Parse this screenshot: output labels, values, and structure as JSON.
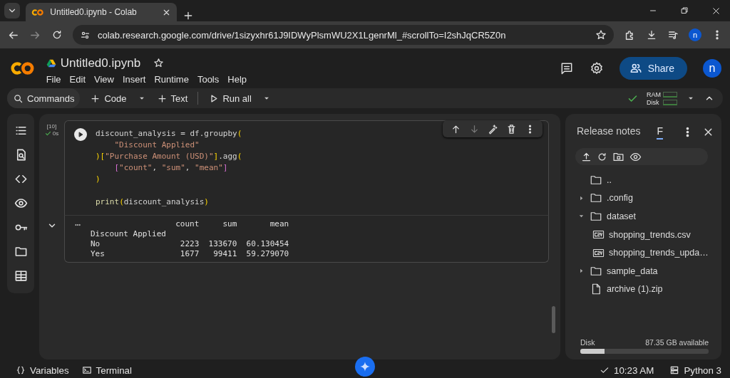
{
  "browser": {
    "tab_title": "Untitled0.ipynb - Colab",
    "url": "colab.research.google.com/drive/1sizyxhr61J9IDWyPlsmWU2X1LgenrMl_#scrollTo=I2shJqCR5Z0n",
    "profile": "n"
  },
  "header": {
    "title": "Untitled0.ipynb",
    "starred": false,
    "menu": [
      "File",
      "Edit",
      "View",
      "Insert",
      "Runtime",
      "Tools",
      "Help"
    ],
    "share": "Share",
    "avatar": "n"
  },
  "toolbar": {
    "commands": "Commands",
    "code": "Code",
    "text": "Text",
    "run_all": "Run all",
    "ram": "RAM",
    "disk": "Disk",
    "connected": true
  },
  "sidebar": [
    {
      "kind": "toc"
    },
    {
      "kind": "find"
    },
    {
      "kind": "snippets"
    },
    {
      "kind": "variables"
    },
    {
      "kind": "secrets"
    },
    {
      "kind": "files"
    },
    {
      "kind": "data"
    }
  ],
  "cell": {
    "exec_count": "[10]",
    "duration": "0s",
    "succeeded": true,
    "toolbar": [
      {
        "kind": "up",
        "disabled": false
      },
      {
        "kind": "down",
        "disabled": true
      },
      {
        "kind": "ai",
        "disabled": false
      },
      {
        "kind": "delete",
        "disabled": false
      },
      {
        "kind": "more",
        "disabled": false
      }
    ],
    "code": [
      {
        "gap": false,
        "indented": false,
        "tokens": [
          {
            "kind": "plain",
            "t": "discount_analysis = df.groupby"
          },
          {
            "kind": "paren",
            "t": "("
          }
        ]
      },
      {
        "gap": false,
        "indented": true,
        "tokens": [
          {
            "kind": "string",
            "t": "\"Discount Applied\""
          }
        ]
      },
      {
        "gap": false,
        "indented": false,
        "tokens": [
          {
            "kind": "paren",
            "t": ")["
          },
          {
            "kind": "string",
            "t": "\"Purchase Amount (USD)\""
          },
          {
            "kind": "paren",
            "t": "]"
          },
          {
            "kind": "plain",
            "t": ".agg"
          },
          {
            "kind": "paren",
            "t": "("
          }
        ]
      },
      {
        "gap": false,
        "indented": true,
        "tokens": [
          {
            "kind": "bracket",
            "t": "["
          },
          {
            "kind": "string",
            "t": "\"count\""
          },
          {
            "kind": "plain",
            "t": ", "
          },
          {
            "kind": "string",
            "t": "\"sum\""
          },
          {
            "kind": "plain",
            "t": ", "
          },
          {
            "kind": "string",
            "t": "\"mean\""
          },
          {
            "kind": "bracket",
            "t": "]"
          }
        ]
      },
      {
        "gap": false,
        "indented": false,
        "tokens": [
          {
            "kind": "paren",
            "t": ")"
          }
        ]
      },
      {
        "gap": true,
        "indented": false,
        "tokens": [
          {
            "kind": "func",
            "t": "print"
          },
          {
            "kind": "paren",
            "t": "("
          },
          {
            "kind": "plain",
            "t": "discount_analysis"
          },
          {
            "kind": "paren",
            "t": ")"
          }
        ]
      }
    ],
    "output_expanded": true,
    "output": [
      "                  count     sum       mean",
      "Discount Applied",
      "No                 2223  133670  60.130454",
      "Yes                1677   99411  59.279070"
    ]
  },
  "files_panel": {
    "tabs": [
      {
        "label": "Release notes",
        "selected": false
      },
      {
        "label": "F",
        "selected": true
      }
    ],
    "tree": [
      {
        "kind": "folder",
        "name": ".."
      },
      {
        "kind": "folder",
        "name": ".config",
        "expanded": false
      },
      {
        "kind": "folder",
        "name": "dataset",
        "expanded": true,
        "children": [
          {
            "kind": "csv",
            "name": "shopping_trends.csv"
          },
          {
            "kind": "csv",
            "name": "shopping_trends_upda…"
          }
        ]
      },
      {
        "kind": "folder",
        "name": "sample_data",
        "expanded": false
      },
      {
        "kind": "file",
        "name": "archive (1).zip"
      }
    ],
    "disk": {
      "label": "Disk",
      "available": "87.35 GB available",
      "level": 0.19
    }
  },
  "status_bar": {
    "variables": "Variables",
    "terminal": "Terminal",
    "time": "10:23 AM",
    "runtime": "Python 3"
  }
}
